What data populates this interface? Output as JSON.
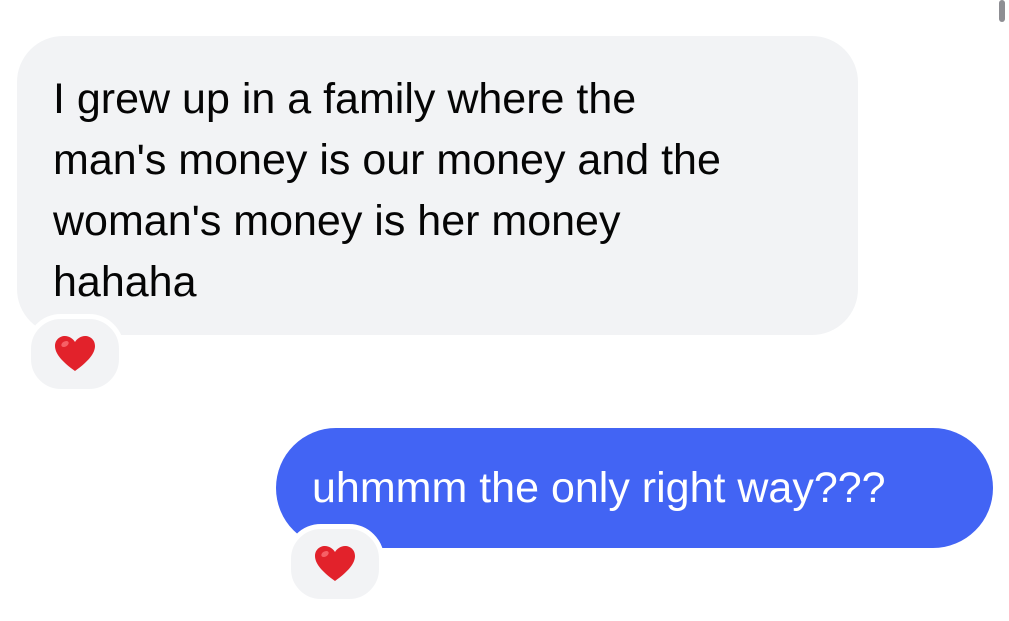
{
  "conversation": {
    "messages": [
      {
        "sender": "incoming",
        "text": "I grew up in a family where the\nman's money is our money and the\nwoman's money is her money\nhahaha",
        "reaction": "heart-icon"
      },
      {
        "sender": "outgoing",
        "text": "uhmmm the only right way???",
        "reaction": "heart-icon"
      }
    ]
  },
  "colors": {
    "incoming_bubble": "#f2f3f5",
    "outgoing_bubble": "#4264f4",
    "incoming_text": "#050505",
    "outgoing_text": "#ffffff",
    "heart": "#e2222b"
  }
}
